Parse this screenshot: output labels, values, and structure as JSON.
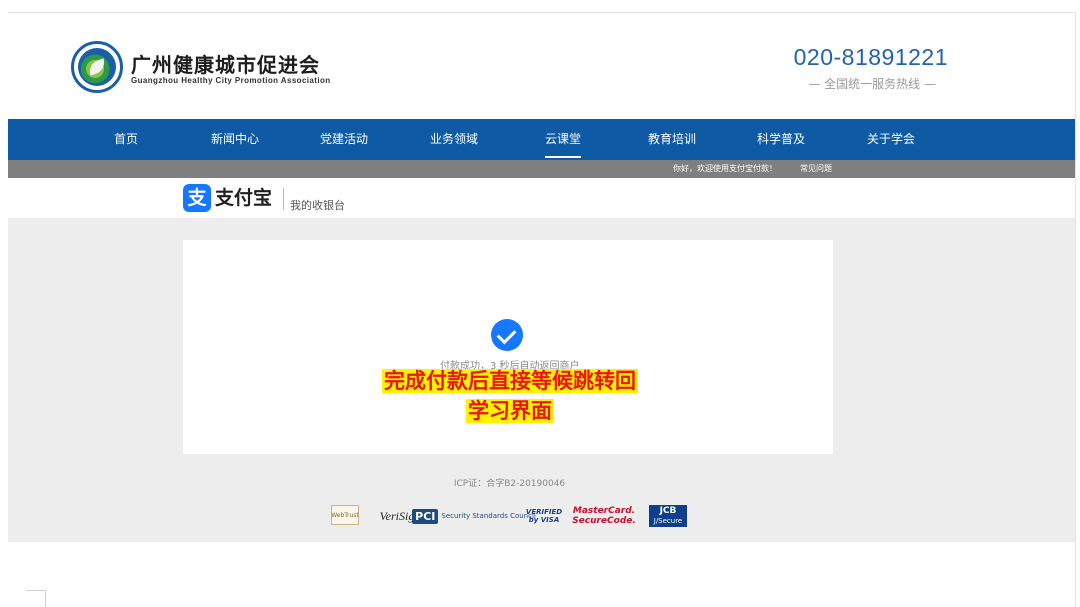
{
  "header": {
    "org_title": "广州健康城市促进会",
    "org_subtitle": "Guangzhou Healthy City Promotion Association",
    "hotline_number": "020-81891221",
    "hotline_label": "— 全国统一服务热线 —"
  },
  "nav": {
    "items": [
      {
        "label": "首页"
      },
      {
        "label": "新闻中心"
      },
      {
        "label": "党建活动"
      },
      {
        "label": "业务领域"
      },
      {
        "label": "云课堂"
      },
      {
        "label": "教育培训"
      },
      {
        "label": "科学普及"
      },
      {
        "label": "关于学会"
      }
    ],
    "active_index": 4
  },
  "infobar": {
    "welcome": "你好，欢迎使用支付宝付款！",
    "faq": "常见问题"
  },
  "alipay": {
    "icon_glyph": "支",
    "brand": "支付宝",
    "cashier": "我的收银台"
  },
  "payment": {
    "success_text": "付款成功，3 秒后自动返回商户",
    "overlay_line1": "完成付款后直接等候跳转回",
    "overlay_line2": "学习界面"
  },
  "footer": {
    "icp": "ICP证：合字B2-20190046",
    "badges": {
      "sem": "WebTrust",
      "verisign": "VeriSign",
      "pci_logo": "PCI",
      "pci_text": "Security Standards Council",
      "visa_line1": "VERIFIED",
      "visa_line2": "by VISA",
      "mc_line1": "MasterCard.",
      "mc_line2": "SecureCode.",
      "jcb_line1": "JCB",
      "jcb_line2": "J/Secure"
    }
  },
  "colors": {
    "nav_blue": "#0f5aa5",
    "hotline_blue": "#2262ae",
    "alipay_blue": "#1677ff",
    "overlay_red": "#e8161b",
    "overlay_yellow": "#fff200"
  }
}
